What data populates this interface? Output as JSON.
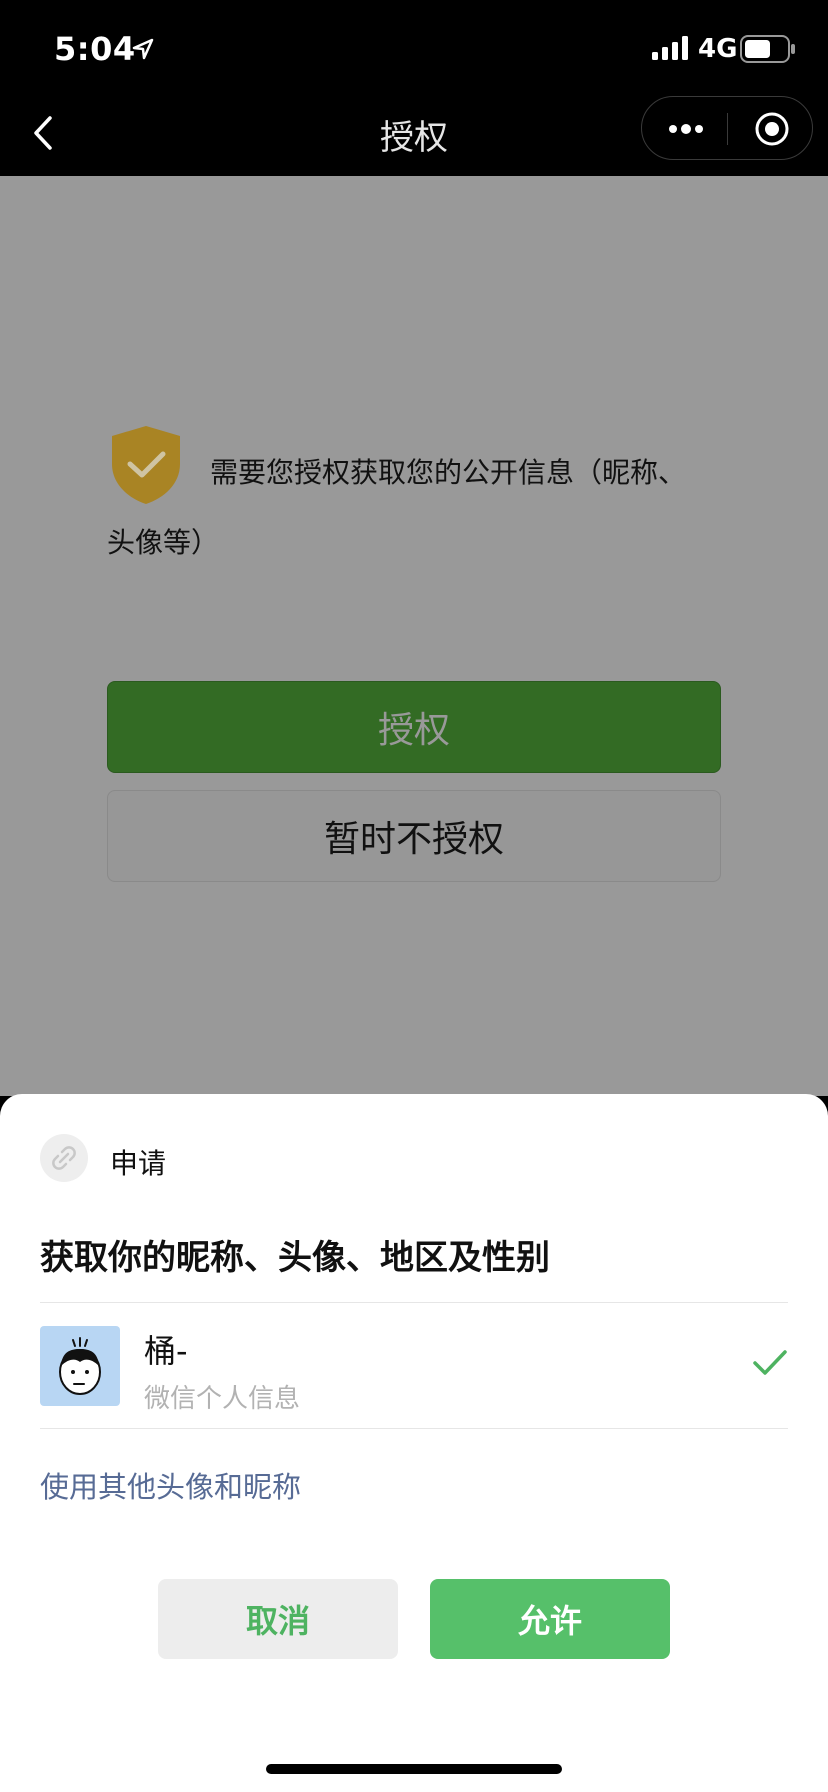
{
  "status_bar": {
    "time": "5:04",
    "network": "4G"
  },
  "nav": {
    "title": "授权"
  },
  "page": {
    "auth_text_line1": "需要您授权获取您的公开信息（昵称、",
    "auth_text_line2": "头像等）",
    "authorize_label": "授权",
    "no_auth_label": "暂时不授权"
  },
  "sheet": {
    "app_name": "申请",
    "request_title": "获取你的昵称、头像、地区及性别",
    "user": {
      "nickname": "桶-",
      "subtitle": "微信个人信息",
      "selected": true
    },
    "use_other_label": "使用其他头像和昵称",
    "cancel_label": "取消",
    "allow_label": "允许"
  },
  "colors": {
    "accent_green": "#56c06a",
    "link_blue": "#576b95",
    "shield_gold": "#c59a2a",
    "overlay_gray": "#999999"
  },
  "icons": {
    "location": "location-arrow-icon",
    "signal": "signal-bars-icon",
    "battery": "battery-icon",
    "back": "back-chevron-icon",
    "more": "more-dots-icon",
    "close_target": "target-circle-icon",
    "shield": "shield-check-icon",
    "app": "link-icon",
    "check": "check-icon"
  }
}
